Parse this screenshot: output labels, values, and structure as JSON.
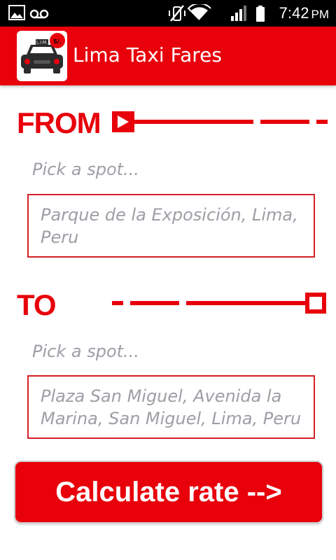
{
  "status_bar": {
    "time": "7:42",
    "ampm": "PM",
    "icons": [
      "image-icon",
      "voicemail-icon",
      "vibrate-off-icon",
      "wifi-icon",
      "signal-icon",
      "battery-icon"
    ]
  },
  "app": {
    "title": "Lima Taxi Fares",
    "logo_text": "L.I.M.",
    "logo_badge": "S/.",
    "brand_color": "#e8000b"
  },
  "from": {
    "label": "FROM",
    "hint": "Pick a spot...",
    "address": "Parque de la Exposición, Lima, Peru",
    "route_icon": "play-icon"
  },
  "to": {
    "label": "TO",
    "hint": "Pick a spot...",
    "address": "Plaza San Miguel, Avenida la Marina, San Miguel, Lima, Peru",
    "route_icon": "stop-square-icon"
  },
  "actions": {
    "calculate_label": "Calculate rate -->"
  }
}
